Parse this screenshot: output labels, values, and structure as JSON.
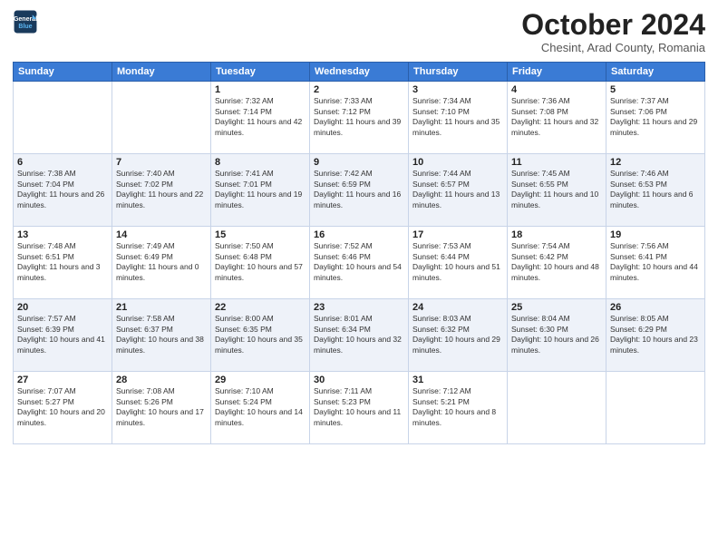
{
  "logo": {
    "line1": "General",
    "line2": "Blue"
  },
  "header": {
    "month": "October 2024",
    "location": "Chesint, Arad County, Romania"
  },
  "weekdays": [
    "Sunday",
    "Monday",
    "Tuesday",
    "Wednesday",
    "Thursday",
    "Friday",
    "Saturday"
  ],
  "weeks": [
    [
      {
        "day": "",
        "info": ""
      },
      {
        "day": "",
        "info": ""
      },
      {
        "day": "1",
        "info": "Sunrise: 7:32 AM\nSunset: 7:14 PM\nDaylight: 11 hours and 42 minutes."
      },
      {
        "day": "2",
        "info": "Sunrise: 7:33 AM\nSunset: 7:12 PM\nDaylight: 11 hours and 39 minutes."
      },
      {
        "day": "3",
        "info": "Sunrise: 7:34 AM\nSunset: 7:10 PM\nDaylight: 11 hours and 35 minutes."
      },
      {
        "day": "4",
        "info": "Sunrise: 7:36 AM\nSunset: 7:08 PM\nDaylight: 11 hours and 32 minutes."
      },
      {
        "day": "5",
        "info": "Sunrise: 7:37 AM\nSunset: 7:06 PM\nDaylight: 11 hours and 29 minutes."
      }
    ],
    [
      {
        "day": "6",
        "info": "Sunrise: 7:38 AM\nSunset: 7:04 PM\nDaylight: 11 hours and 26 minutes."
      },
      {
        "day": "7",
        "info": "Sunrise: 7:40 AM\nSunset: 7:02 PM\nDaylight: 11 hours and 22 minutes."
      },
      {
        "day": "8",
        "info": "Sunrise: 7:41 AM\nSunset: 7:01 PM\nDaylight: 11 hours and 19 minutes."
      },
      {
        "day": "9",
        "info": "Sunrise: 7:42 AM\nSunset: 6:59 PM\nDaylight: 11 hours and 16 minutes."
      },
      {
        "day": "10",
        "info": "Sunrise: 7:44 AM\nSunset: 6:57 PM\nDaylight: 11 hours and 13 minutes."
      },
      {
        "day": "11",
        "info": "Sunrise: 7:45 AM\nSunset: 6:55 PM\nDaylight: 11 hours and 10 minutes."
      },
      {
        "day": "12",
        "info": "Sunrise: 7:46 AM\nSunset: 6:53 PM\nDaylight: 11 hours and 6 minutes."
      }
    ],
    [
      {
        "day": "13",
        "info": "Sunrise: 7:48 AM\nSunset: 6:51 PM\nDaylight: 11 hours and 3 minutes."
      },
      {
        "day": "14",
        "info": "Sunrise: 7:49 AM\nSunset: 6:49 PM\nDaylight: 11 hours and 0 minutes."
      },
      {
        "day": "15",
        "info": "Sunrise: 7:50 AM\nSunset: 6:48 PM\nDaylight: 10 hours and 57 minutes."
      },
      {
        "day": "16",
        "info": "Sunrise: 7:52 AM\nSunset: 6:46 PM\nDaylight: 10 hours and 54 minutes."
      },
      {
        "day": "17",
        "info": "Sunrise: 7:53 AM\nSunset: 6:44 PM\nDaylight: 10 hours and 51 minutes."
      },
      {
        "day": "18",
        "info": "Sunrise: 7:54 AM\nSunset: 6:42 PM\nDaylight: 10 hours and 48 minutes."
      },
      {
        "day": "19",
        "info": "Sunrise: 7:56 AM\nSunset: 6:41 PM\nDaylight: 10 hours and 44 minutes."
      }
    ],
    [
      {
        "day": "20",
        "info": "Sunrise: 7:57 AM\nSunset: 6:39 PM\nDaylight: 10 hours and 41 minutes."
      },
      {
        "day": "21",
        "info": "Sunrise: 7:58 AM\nSunset: 6:37 PM\nDaylight: 10 hours and 38 minutes."
      },
      {
        "day": "22",
        "info": "Sunrise: 8:00 AM\nSunset: 6:35 PM\nDaylight: 10 hours and 35 minutes."
      },
      {
        "day": "23",
        "info": "Sunrise: 8:01 AM\nSunset: 6:34 PM\nDaylight: 10 hours and 32 minutes."
      },
      {
        "day": "24",
        "info": "Sunrise: 8:03 AM\nSunset: 6:32 PM\nDaylight: 10 hours and 29 minutes."
      },
      {
        "day": "25",
        "info": "Sunrise: 8:04 AM\nSunset: 6:30 PM\nDaylight: 10 hours and 26 minutes."
      },
      {
        "day": "26",
        "info": "Sunrise: 8:05 AM\nSunset: 6:29 PM\nDaylight: 10 hours and 23 minutes."
      }
    ],
    [
      {
        "day": "27",
        "info": "Sunrise: 7:07 AM\nSunset: 5:27 PM\nDaylight: 10 hours and 20 minutes."
      },
      {
        "day": "28",
        "info": "Sunrise: 7:08 AM\nSunset: 5:26 PM\nDaylight: 10 hours and 17 minutes."
      },
      {
        "day": "29",
        "info": "Sunrise: 7:10 AM\nSunset: 5:24 PM\nDaylight: 10 hours and 14 minutes."
      },
      {
        "day": "30",
        "info": "Sunrise: 7:11 AM\nSunset: 5:23 PM\nDaylight: 10 hours and 11 minutes."
      },
      {
        "day": "31",
        "info": "Sunrise: 7:12 AM\nSunset: 5:21 PM\nDaylight: 10 hours and 8 minutes."
      },
      {
        "day": "",
        "info": ""
      },
      {
        "day": "",
        "info": ""
      }
    ]
  ]
}
